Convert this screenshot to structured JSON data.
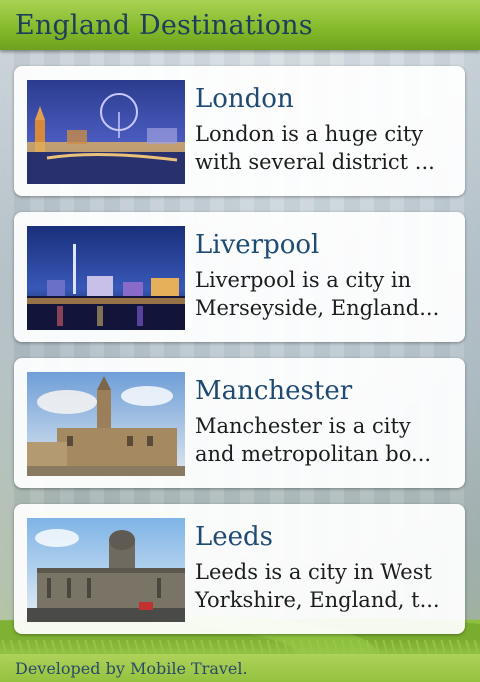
{
  "header": {
    "title": "England Destinations"
  },
  "destinations": [
    {
      "name": "London",
      "desc_line1": "London is a huge city",
      "desc_line2": "with several district ...",
      "image": "london-skyline-night-photo"
    },
    {
      "name": "Liverpool",
      "desc_line1": "Liverpool is a city in",
      "desc_line2": "Merseyside, England...",
      "image": "liverpool-waterfront-night-photo"
    },
    {
      "name": "Manchester",
      "desc_line1": "Manchester is a city",
      "desc_line2": "and metropolitan bo...",
      "image": "manchester-town-hall-photo"
    },
    {
      "name": "Leeds",
      "desc_line1": "Leeds is a city in West",
      "desc_line2": "Yorkshire, England, t...",
      "image": "leeds-town-hall-photo"
    }
  ],
  "footer": {
    "credit": "Developed by Mobile Travel."
  },
  "colors": {
    "header_green": "#86bb2c",
    "title_blue": "#1d3d5c",
    "name_blue": "#1f4a72"
  }
}
